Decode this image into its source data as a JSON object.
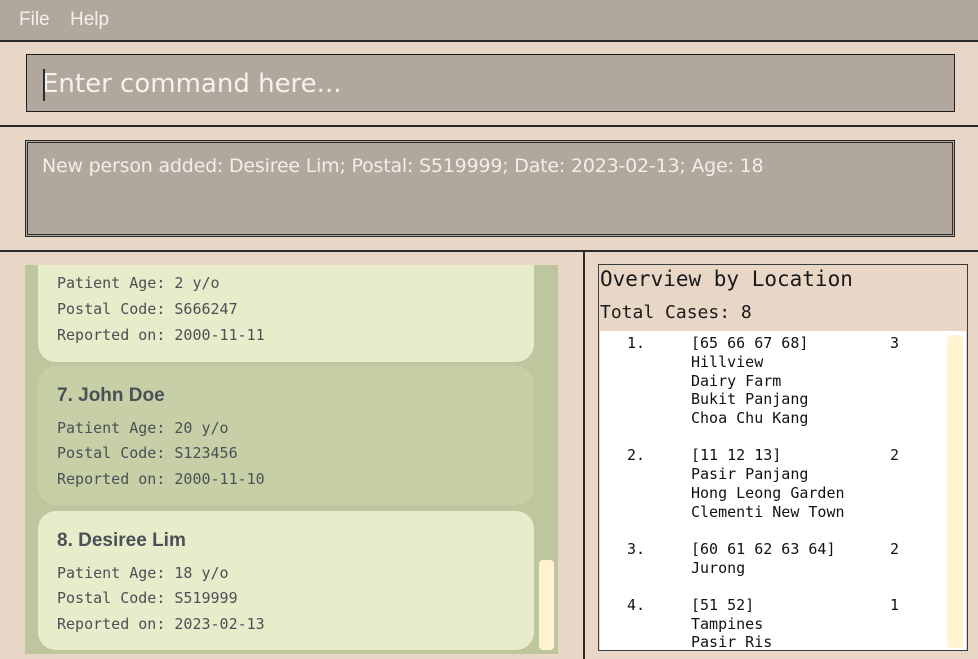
{
  "menu": {
    "file": "File",
    "help": "Help"
  },
  "command": {
    "placeholder": "Enter command here...",
    "value": ""
  },
  "result": {
    "message": "New person added: Desiree Lim; Postal: S519999; Date: 2023-02-13; Age: 18"
  },
  "persons": [
    {
      "title": "",
      "age": "Patient Age: 2 y/o",
      "postal": "Postal Code: S666247",
      "reported": "Reported on: 2000-11-11"
    },
    {
      "title": "7. John Doe",
      "age": "Patient Age: 20 y/o",
      "postal": "Postal Code: S123456",
      "reported": "Reported on: 2000-11-10"
    },
    {
      "title": "8. Desiree Lim",
      "age": "Patient Age: 18 y/o",
      "postal": "Postal Code: S519999",
      "reported": "Reported on: 2023-02-13"
    }
  ],
  "overview": {
    "title": "Overview by Location",
    "total": "Total Cases: 8",
    "entries": [
      {
        "index": "1.",
        "codes": "[65 66 67 68]",
        "count": "3",
        "areas": [
          "Hillview",
          "Dairy Farm",
          "Bukit Panjang",
          "Choa Chu Kang"
        ]
      },
      {
        "index": "2.",
        "codes": "[11 12 13]",
        "count": "2",
        "areas": [
          "Pasir Panjang",
          "Hong Leong Garden",
          "Clementi New Town"
        ]
      },
      {
        "index": "3.",
        "codes": "[60 61 62 63 64]",
        "count": "2",
        "areas": [
          "Jurong"
        ]
      },
      {
        "index": "4.",
        "codes": "[51 52]",
        "count": "1",
        "areas": [
          "Tampines",
          "Pasir Ris"
        ]
      }
    ]
  }
}
